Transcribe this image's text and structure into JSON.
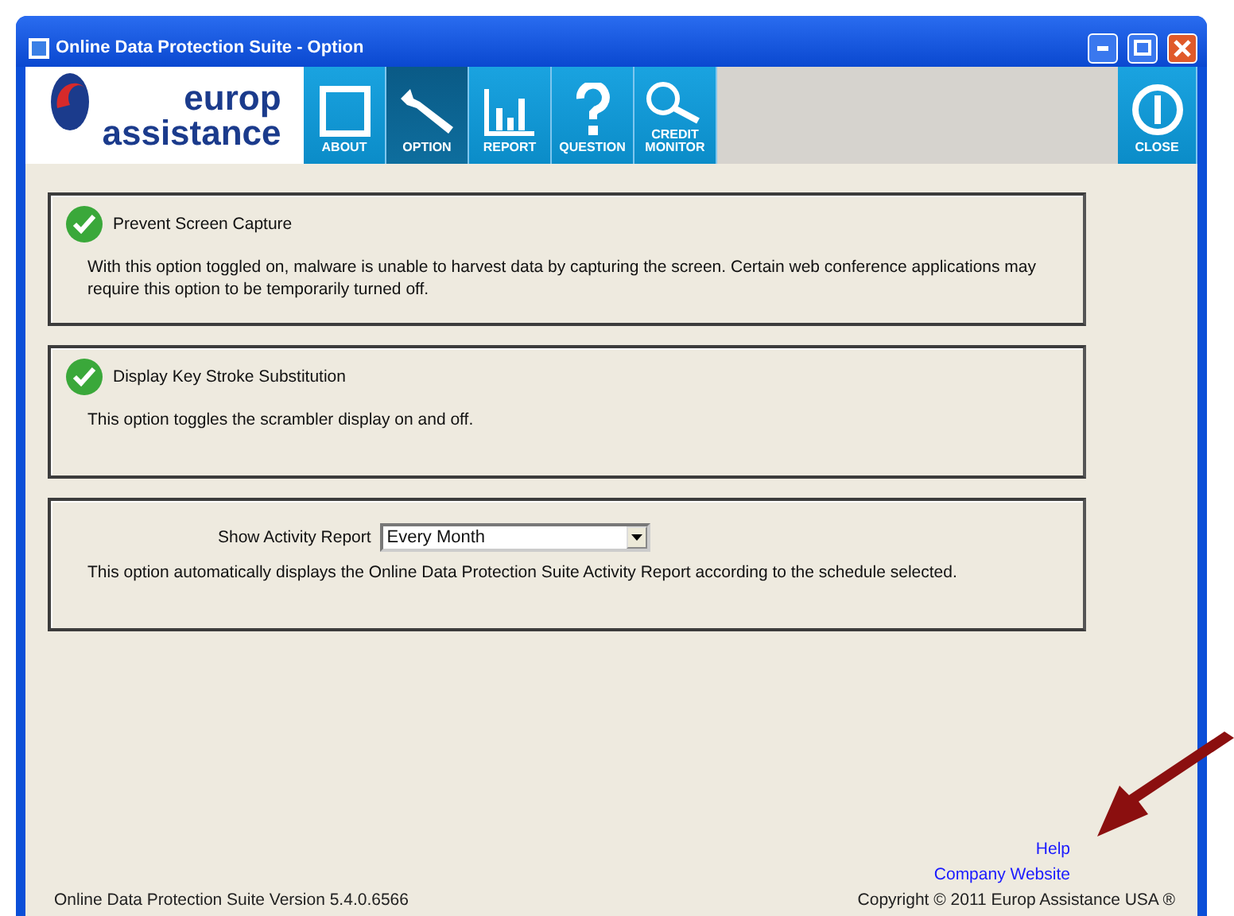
{
  "window": {
    "title": "Online Data Protection Suite - Option"
  },
  "logo": {
    "line_1": "europ",
    "line_2": "assistance"
  },
  "toolbar": [
    {
      "label": "ABOUT",
      "selected": false
    },
    {
      "label": "OPTION",
      "selected": true
    },
    {
      "label": "REPORT",
      "selected": false
    },
    {
      "label": "QUESTION",
      "selected": false
    },
    {
      "label": "CREDIT MONITOR",
      "selected": false
    }
  ],
  "close_button": {
    "label": "CLOSE"
  },
  "options": [
    {
      "kind": "check",
      "title": "Prevent Screen Capture",
      "checked": true,
      "description": "With this option toggled on, malware is unable to harvest data by capturing the screen. Certain web conference applications may require this option to be temporarily turned off."
    },
    {
      "kind": "check",
      "title": "Display Key Stroke Substitution",
      "checked": true,
      "description": "This option toggles the scrambler display on and off."
    },
    {
      "kind": "select",
      "title": "Show Activity Report",
      "value": "Every Month",
      "description": "This option automatically displays the Online Data Protection Suite Activity Report according to the schedule selected."
    }
  ],
  "links": [
    "Help",
    "Company Website"
  ],
  "status_bar": {
    "version": "Online Data Protection Suite Version 5.4.0.6566",
    "copyright": "Copyright © 2011 Europ Assistance USA ®"
  }
}
